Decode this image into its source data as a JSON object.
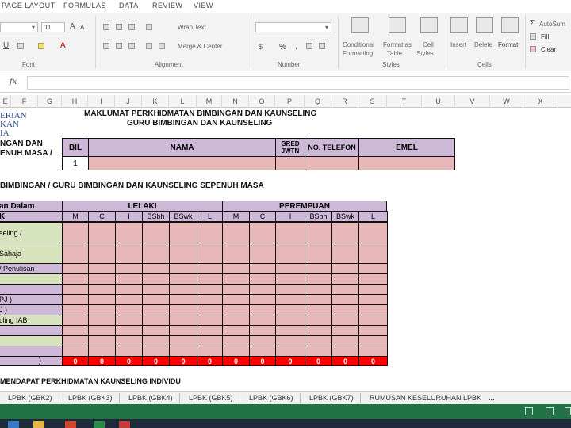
{
  "menu_tabs": [
    "PAGE LAYOUT",
    "FORMULAS",
    "DATA",
    "REVIEW",
    "VIEW"
  ],
  "ribbon": {
    "font_size": "11",
    "font_grow": "A",
    "font_shrink": "A",
    "wrap_text": "Wrap Text",
    "merge_center": "Merge & Center",
    "percent": "%",
    "comma": ",",
    "conditional_formatting": [
      "Conditional",
      "Formatting"
    ],
    "format_as_table": [
      "Format as",
      "Table"
    ],
    "cell_styles": [
      "Cell",
      "Styles"
    ],
    "insert": "Insert",
    "delete": "Delete",
    "format": "Format",
    "autosum": "AutoSum",
    "fill": "Fill",
    "clear": "Clear",
    "groups": {
      "font": "Font",
      "alignment": "Alignment",
      "number": "Number",
      "styles": "Styles",
      "cells": "Cells"
    }
  },
  "formula_bar": {
    "fx": "fx",
    "value": ""
  },
  "columns": [
    "E",
    "F",
    "G",
    "H",
    "I",
    "J",
    "K",
    "L",
    "M",
    "N",
    "O",
    "P",
    "Q",
    "R",
    "S",
    "T",
    "U",
    "V",
    "W",
    "X"
  ],
  "sheet": {
    "logo_lines": [
      "ERIAN",
      "KAN",
      "IA"
    ],
    "main_title": "MAKLUMAT PERKHIDMATAN BIMBINGAN DAN KAUNSELING",
    "sub_title": "GURU BIMBINGAN DAN KAUNSELING",
    "left_label_1": "NGAN DAN",
    "left_label_2": "ENUH MASA /",
    "table1": {
      "headers": {
        "bil": "BIL",
        "nama": "NAMA",
        "gred_1": "GRED",
        "gred_2": "JWTN",
        "telefon": "NO. TELEFON",
        "emel": "EMEL"
      },
      "row_bil": "1"
    },
    "section2_title": "BIMBINGAN / GURU BIMBINGAN DAN KAUNSELING SEPENUH MASA",
    "table2": {
      "left_header_1": "an Dalam",
      "left_header_2": "K",
      "group_lelaki": "LELAKI",
      "group_perempuan": "PEREMPUAN",
      "sub_headers": [
        "M",
        "C",
        "I",
        "BSbh",
        "BSwk",
        "L",
        "M",
        "C",
        "I",
        "BSbh",
        "BSwk",
        "L"
      ],
      "row_labels": [
        "seling /",
        "Sahaja",
        "/ Penulisan",
        "",
        "",
        "PJ )",
        "J )",
        "cling IAB",
        "",
        "",
        "",
        ")"
      ],
      "totals": [
        "0",
        "0",
        "0",
        "0",
        "0",
        "0",
        "0",
        "0",
        "0",
        "0",
        "0",
        "0"
      ]
    },
    "section3_title": "MENDAPAT PERKHIDMATAN KAUNSELING  INDIVIDU"
  },
  "sheet_tabs": [
    "LPBK (GBK2)",
    "LPBK (GBK3)",
    "LPBK (GBK4)",
    "LPBK (GBK5)",
    "LPBK (GBK6)",
    "LPBK (GBK7)",
    "RUMUSAN KESELURUHAN LPBK"
  ],
  "sheet_tabs_more": "...",
  "colors": {
    "header_purple": "#cdb8d8",
    "cell_pink": "#e8b7b7",
    "label_green": "#d6e3bc",
    "total_red": "#ff0000",
    "status_green": "#217346"
  }
}
